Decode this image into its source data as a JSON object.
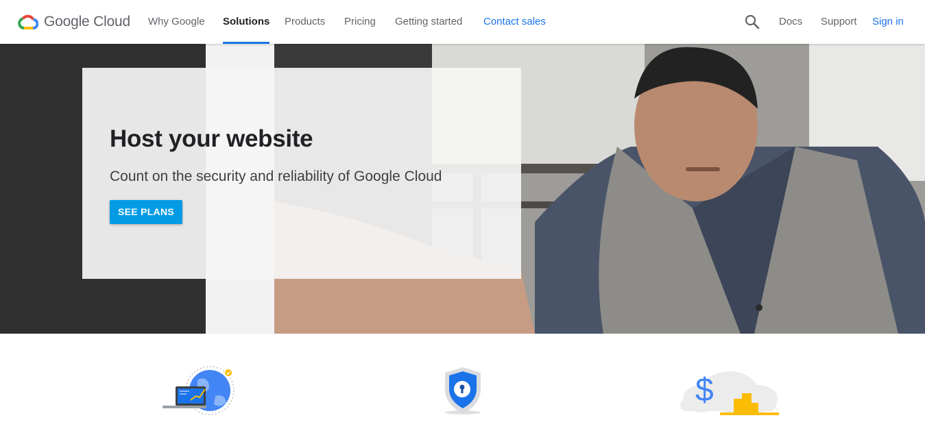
{
  "brand": {
    "name": "Google Cloud",
    "logo_icon": "google-cloud-logo-icon"
  },
  "nav": {
    "items": [
      {
        "label": "Why Google"
      },
      {
        "label": "Solutions"
      },
      {
        "label": "Products"
      },
      {
        "label": "Pricing"
      },
      {
        "label": "Getting started"
      },
      {
        "label": "Contact sales"
      }
    ],
    "active": "Solutions"
  },
  "header_right": {
    "search_icon": "search-icon",
    "docs": "Docs",
    "support": "Support",
    "sign_in": "Sign in"
  },
  "hero": {
    "title": "Host your website",
    "subtitle": "Count on the security and reliability of Google Cloud",
    "cta": "SEE PLANS"
  },
  "features": [
    {
      "icon": "globe-laptop-icon"
    },
    {
      "icon": "shield-lock-icon"
    },
    {
      "icon": "dollar-cloud-icon"
    }
  ],
  "colors": {
    "accent_blue": "#1a73e8",
    "cta_blue": "#039be5",
    "google_yellow": "#fbbc04",
    "google_red": "#ea4335",
    "google_green": "#34a853",
    "text_grey": "#5f6368"
  }
}
